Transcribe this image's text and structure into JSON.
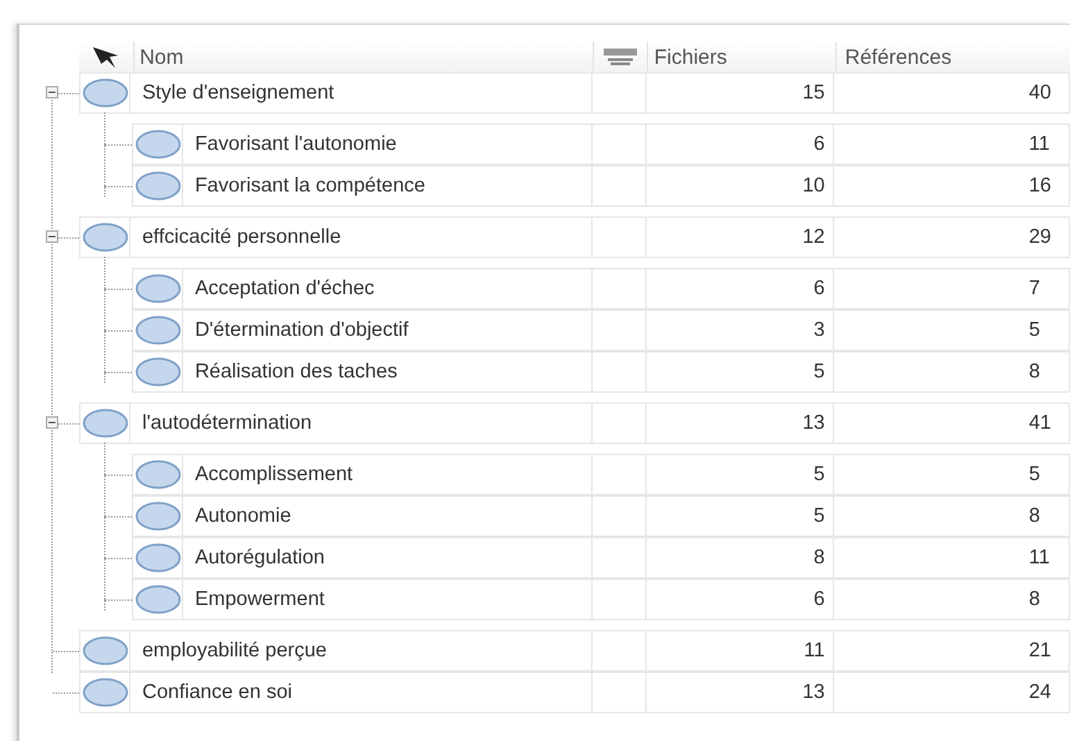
{
  "columns": {
    "name": "Nom",
    "files": "Fichiers",
    "refs": "Références"
  },
  "nodes": [
    {
      "name": "Style d'enseignement",
      "files": "15",
      "refs": "40",
      "expanded": true,
      "children": [
        {
          "name": "Favorisant l'autonomie",
          "files": "6",
          "refs": "11"
        },
        {
          "name": "Favorisant la compétence",
          "files": "10",
          "refs": "16"
        }
      ]
    },
    {
      "name": "effcicacité personnelle",
      "files": "12",
      "refs": "29",
      "expanded": true,
      "children": [
        {
          "name": "Acceptation d'échec",
          "files": "6",
          "refs": "7"
        },
        {
          "name": "D'étermination d'objectif",
          "files": "3",
          "refs": "5"
        },
        {
          "name": "Réalisation des taches",
          "files": "5",
          "refs": "8"
        }
      ]
    },
    {
      "name": "l'autodétermination",
      "files": "13",
      "refs": "41",
      "expanded": true,
      "children": [
        {
          "name": "Accomplissement",
          "files": "5",
          "refs": "5"
        },
        {
          "name": "Autonomie",
          "files": "5",
          "refs": "8"
        },
        {
          "name": "Autorégulation",
          "files": "8",
          "refs": "11"
        },
        {
          "name": "Empowerment",
          "files": "6",
          "refs": "8"
        }
      ]
    },
    {
      "name": "employabilité perçue",
      "files": "11",
      "refs": "21"
    },
    {
      "name": "Confiance en soi",
      "files": "13",
      "refs": "24"
    }
  ]
}
